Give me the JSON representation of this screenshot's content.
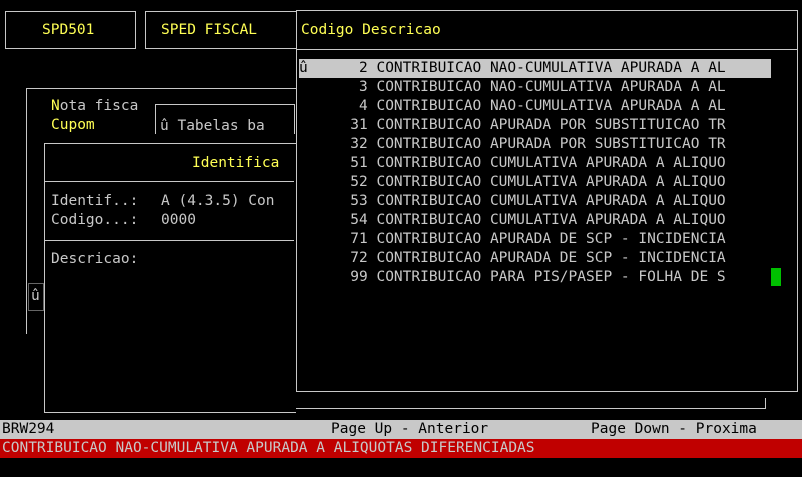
{
  "header": {
    "program_code": "SPD501",
    "system_name": "SPED FISCAL"
  },
  "background_form": {
    "label_nota": "Nota fisca",
    "label_cupom": "Cupom",
    "tabelas_field": "û Tabelas ba",
    "section_title": "Identifica",
    "identif_label": "Identif..:",
    "identif_value": "A (4.3.5) Con",
    "codigo_label": "Codigo...:",
    "codigo_value": "0000",
    "descricao_label": "Descricao:",
    "side_marker": "û"
  },
  "lookup": {
    "header_label": "Codigo Descricao",
    "selected_marker": "û",
    "rows": [
      {
        "code": "2",
        "desc": "CONTRIBUICAO NAO-CUMULATIVA APURADA A AL"
      },
      {
        "code": "3",
        "desc": "CONTRIBUICAO NAO-CUMULATIVA APURADA A AL"
      },
      {
        "code": "4",
        "desc": "CONTRIBUICAO NAO-CUMULATIVA APURADA A AL"
      },
      {
        "code": "31",
        "desc": "CONTRIBUICAO APURADA POR SUBSTITUICAO TR"
      },
      {
        "code": "32",
        "desc": "CONTRIBUICAO APURADA POR SUBSTITUICAO TR"
      },
      {
        "code": "51",
        "desc": "CONTRIBUICAO CUMULATIVA APURADA A ALIQUO"
      },
      {
        "code": "52",
        "desc": "CONTRIBUICAO CUMULATIVA APURADA A ALIQUO"
      },
      {
        "code": "53",
        "desc": "CONTRIBUICAO CUMULATIVA APURADA A ALIQUO"
      },
      {
        "code": "54",
        "desc": "CONTRIBUICAO CUMULATIVA APURADA A ALIQUO"
      },
      {
        "code": "71",
        "desc": "CONTRIBUICAO APURADA DE SCP - INCIDENCIA"
      },
      {
        "code": "72",
        "desc": "CONTRIBUICAO APURADA DE SCP - INCIDENCIA"
      },
      {
        "code": "99",
        "desc": "CONTRIBUICAO PARA PIS/PASEP - FOLHA DE S"
      }
    ]
  },
  "status_bar": {
    "screen_id": "BRW294",
    "page_up": "Page Up - Anterior",
    "page_down": "Page Down - Proxima"
  },
  "description_bar": {
    "text": "CONTRIBUICAO NAO-CUMULATIVA APURADA A ALIQUOTAS DIFERENCIADAS"
  },
  "colors": {
    "background": "#000000",
    "text": "#c8c8c8",
    "highlight": "#ffff55",
    "selection": "#c8c8c8",
    "status_bar": "#c8c8c8",
    "description_bar": "#c00000",
    "cursor": "#00c000"
  }
}
